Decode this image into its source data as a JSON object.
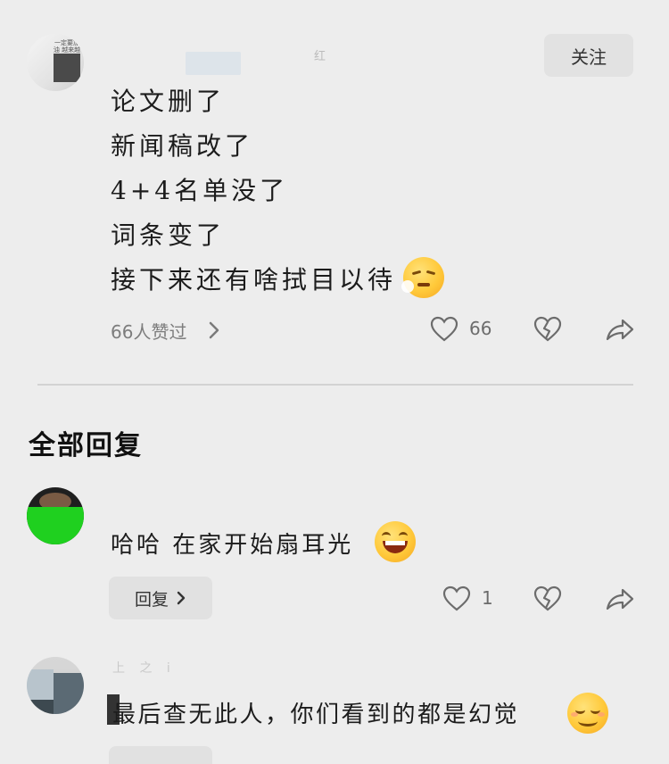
{
  "post": {
    "author_suffix": "红",
    "avatar_text": "一定要加油 越来越好",
    "follow_label": "关注",
    "lines": [
      "论文删了",
      "新闻稿改了",
      "4+4名单没了",
      "词条变了",
      "接下来还有啥拭目以待"
    ],
    "likes_summary": "66人赞过",
    "like_count": "66"
  },
  "section": {
    "title": "全部回复"
  },
  "replies": [
    {
      "text": "哈哈 在家开始扇耳光",
      "reply_label": "回复",
      "like_count": "1"
    },
    {
      "name_partial": "上 之 i",
      "text": "最后查无此人，你们看到的都是幻觉"
    }
  ],
  "icons": {
    "chevron": "chevron-right-icon",
    "like": "heart-outline-icon",
    "dislike": "broken-heart-icon",
    "share": "share-arrow-icon"
  }
}
